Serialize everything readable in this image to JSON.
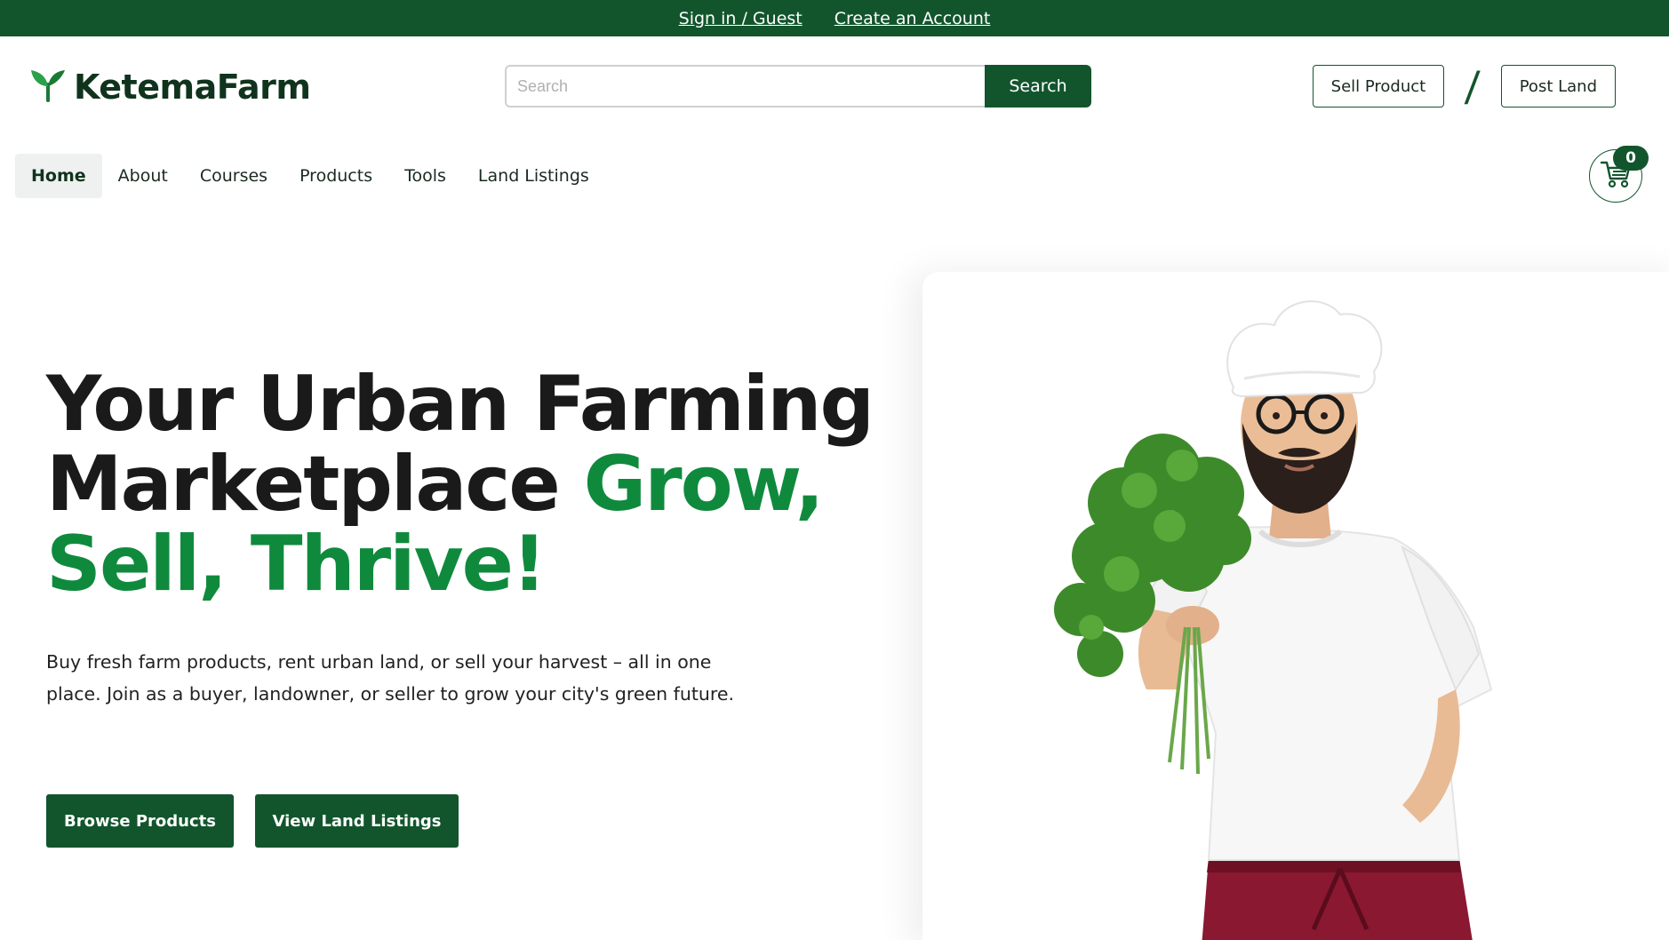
{
  "topbar": {
    "sign_in": "Sign in / Guest",
    "create_account": "Create an Account"
  },
  "brand": {
    "name": "KetemaFarm",
    "logo_icon": "sprout-icon",
    "primary_color": "#12552d",
    "accent_color": "#0f8a3d"
  },
  "search": {
    "placeholder": "Search",
    "value": "",
    "button_label": "Search"
  },
  "header_actions": {
    "sell_product": "Sell Product",
    "separator": "/",
    "post_land": "Post Land"
  },
  "nav": {
    "items": [
      {
        "label": "Home",
        "active": true
      },
      {
        "label": "About"
      },
      {
        "label": "Courses"
      },
      {
        "label": "Products"
      },
      {
        "label": "Tools"
      },
      {
        "label": "Land Listings"
      }
    ]
  },
  "cart": {
    "icon": "cart-icon",
    "count": "0"
  },
  "hero": {
    "title_part1": "Your Urban Farming Marketplace ",
    "title_highlight": "Grow, Sell, Thrive!",
    "subtitle": "Buy fresh farm products, rent urban land, or sell your harvest – all in one place. Join as a buyer, landowner, or seller to grow your city's green future.",
    "cta_primary": "Browse Products",
    "cta_secondary": "View Land Listings",
    "image": "chef-holding-parsley"
  }
}
